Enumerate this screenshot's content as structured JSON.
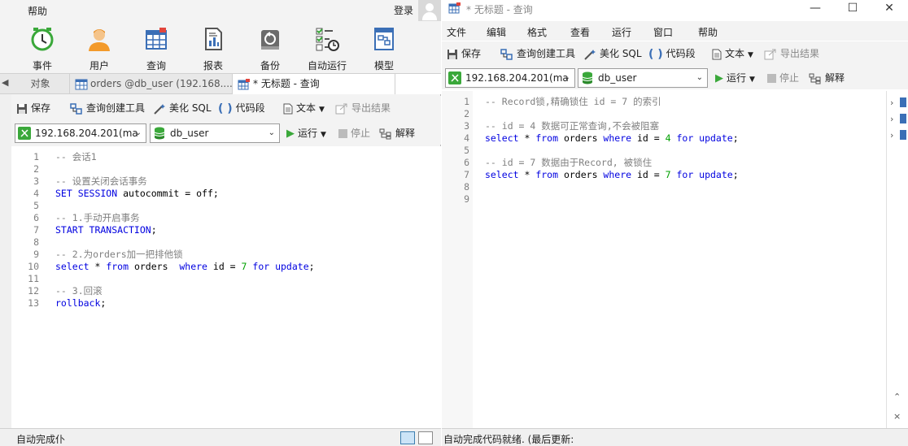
{
  "left_window": {
    "menu": {
      "help": "帮助",
      "login": "登录"
    },
    "ribbon": [
      {
        "label": "事件",
        "icon": "clock-icon"
      },
      {
        "label": "用户",
        "icon": "user-icon"
      },
      {
        "label": "查询",
        "icon": "query-icon"
      },
      {
        "label": "报表",
        "icon": "report-icon"
      },
      {
        "label": "备份",
        "icon": "backup-icon"
      },
      {
        "label": "自动运行",
        "icon": "automation-icon"
      },
      {
        "label": "模型",
        "icon": "model-icon"
      }
    ],
    "tabs": [
      {
        "label": "对象"
      },
      {
        "label": "orders @db_user (192.168...."
      },
      {
        "label": "* 无标题 - 查询"
      }
    ],
    "toolbar": {
      "save": "保存",
      "query_builder": "查询创建工具",
      "beautify": "美化 SQL",
      "snippet": "代码段",
      "text": "文本",
      "export": "导出结果"
    },
    "connection": {
      "host": "192.168.204.201(ma",
      "database": "db_user",
      "run": "运行",
      "stop": "停止",
      "explain": "解释"
    },
    "code": [
      {
        "n": "1",
        "parts": [
          {
            "t": "-- 会话1",
            "c": "cmt"
          }
        ]
      },
      {
        "n": "2",
        "parts": []
      },
      {
        "n": "3",
        "parts": [
          {
            "t": "-- 设置关闭会话事务",
            "c": "cmt"
          }
        ]
      },
      {
        "n": "4",
        "parts": [
          {
            "t": "SET SESSION",
            "c": "kw"
          },
          {
            "t": " autocommit = off;",
            "c": "plain"
          }
        ]
      },
      {
        "n": "5",
        "parts": []
      },
      {
        "n": "6",
        "parts": [
          {
            "t": "-- 1.手动开启事务",
            "c": "cmt"
          }
        ]
      },
      {
        "n": "7",
        "parts": [
          {
            "t": "START TRANSACTION",
            "c": "kw"
          },
          {
            "t": ";",
            "c": "plain"
          }
        ]
      },
      {
        "n": "8",
        "parts": []
      },
      {
        "n": "9",
        "parts": [
          {
            "t": "-- 2.为orders加一把排他锁",
            "c": "cmt"
          }
        ]
      },
      {
        "n": "10",
        "parts": [
          {
            "t": "select",
            "c": "kw"
          },
          {
            "t": " * ",
            "c": "plain"
          },
          {
            "t": "from",
            "c": "kw"
          },
          {
            "t": " orders  ",
            "c": "plain"
          },
          {
            "t": "where",
            "c": "kw"
          },
          {
            "t": " id = ",
            "c": "plain"
          },
          {
            "t": "7",
            "c": "num"
          },
          {
            "t": " ",
            "c": "plain"
          },
          {
            "t": "for update",
            "c": "kw"
          },
          {
            "t": ";",
            "c": "plain"
          }
        ]
      },
      {
        "n": "11",
        "parts": []
      },
      {
        "n": "12",
        "parts": [
          {
            "t": "-- 3.回滚",
            "c": "cmt"
          }
        ]
      },
      {
        "n": "13",
        "parts": [
          {
            "t": "rollback",
            "c": "kw"
          },
          {
            "t": ";",
            "c": "plain"
          }
        ]
      }
    ],
    "status": "自动完成仆"
  },
  "right_window": {
    "title": "* 无标题 - 查询",
    "menu": [
      "文件",
      "编辑",
      "格式",
      "查看",
      "运行",
      "窗口",
      "帮助"
    ],
    "toolbar": {
      "save": "保存",
      "query_builder": "查询创建工具",
      "beautify": "美化 SQL",
      "snippet": "代码段",
      "text": "文本",
      "export": "导出结果"
    },
    "connection": {
      "host": "192.168.204.201(ma",
      "database": "db_user",
      "run": "运行",
      "stop": "停止",
      "explain": "解释"
    },
    "code": [
      {
        "n": "1",
        "parts": [
          {
            "t": "-- Record锁,精确锁住 id = 7 的索引",
            "c": "cmt"
          }
        ]
      },
      {
        "n": "2",
        "parts": []
      },
      {
        "n": "3",
        "parts": [
          {
            "t": "-- id = 4 数据可正常查询,不会被阻塞",
            "c": "cmt"
          }
        ]
      },
      {
        "n": "4",
        "parts": [
          {
            "t": "select",
            "c": "kw"
          },
          {
            "t": " * ",
            "c": "plain"
          },
          {
            "t": "from",
            "c": "kw"
          },
          {
            "t": " orders ",
            "c": "plain"
          },
          {
            "t": "where",
            "c": "kw"
          },
          {
            "t": " id = ",
            "c": "plain"
          },
          {
            "t": "4",
            "c": "num"
          },
          {
            "t": " ",
            "c": "plain"
          },
          {
            "t": "for update",
            "c": "kw"
          },
          {
            "t": ";",
            "c": "plain"
          }
        ]
      },
      {
        "n": "5",
        "parts": []
      },
      {
        "n": "6",
        "parts": [
          {
            "t": "-- id = 7 数据由于Record, 被锁住",
            "c": "cmt"
          }
        ]
      },
      {
        "n": "7",
        "parts": [
          {
            "t": "select",
            "c": "kw"
          },
          {
            "t": " * ",
            "c": "plain"
          },
          {
            "t": "from",
            "c": "kw"
          },
          {
            "t": " orders ",
            "c": "plain"
          },
          {
            "t": "where",
            "c": "kw"
          },
          {
            "t": " id = ",
            "c": "plain"
          },
          {
            "t": "7",
            "c": "num"
          },
          {
            "t": " ",
            "c": "plain"
          },
          {
            "t": "for update",
            "c": "kw"
          },
          {
            "t": ";",
            "c": "plain"
          }
        ]
      },
      {
        "n": "8",
        "parts": []
      },
      {
        "n": "9",
        "parts": []
      }
    ],
    "status": "自动完成代码就绪. (最后更新:"
  }
}
